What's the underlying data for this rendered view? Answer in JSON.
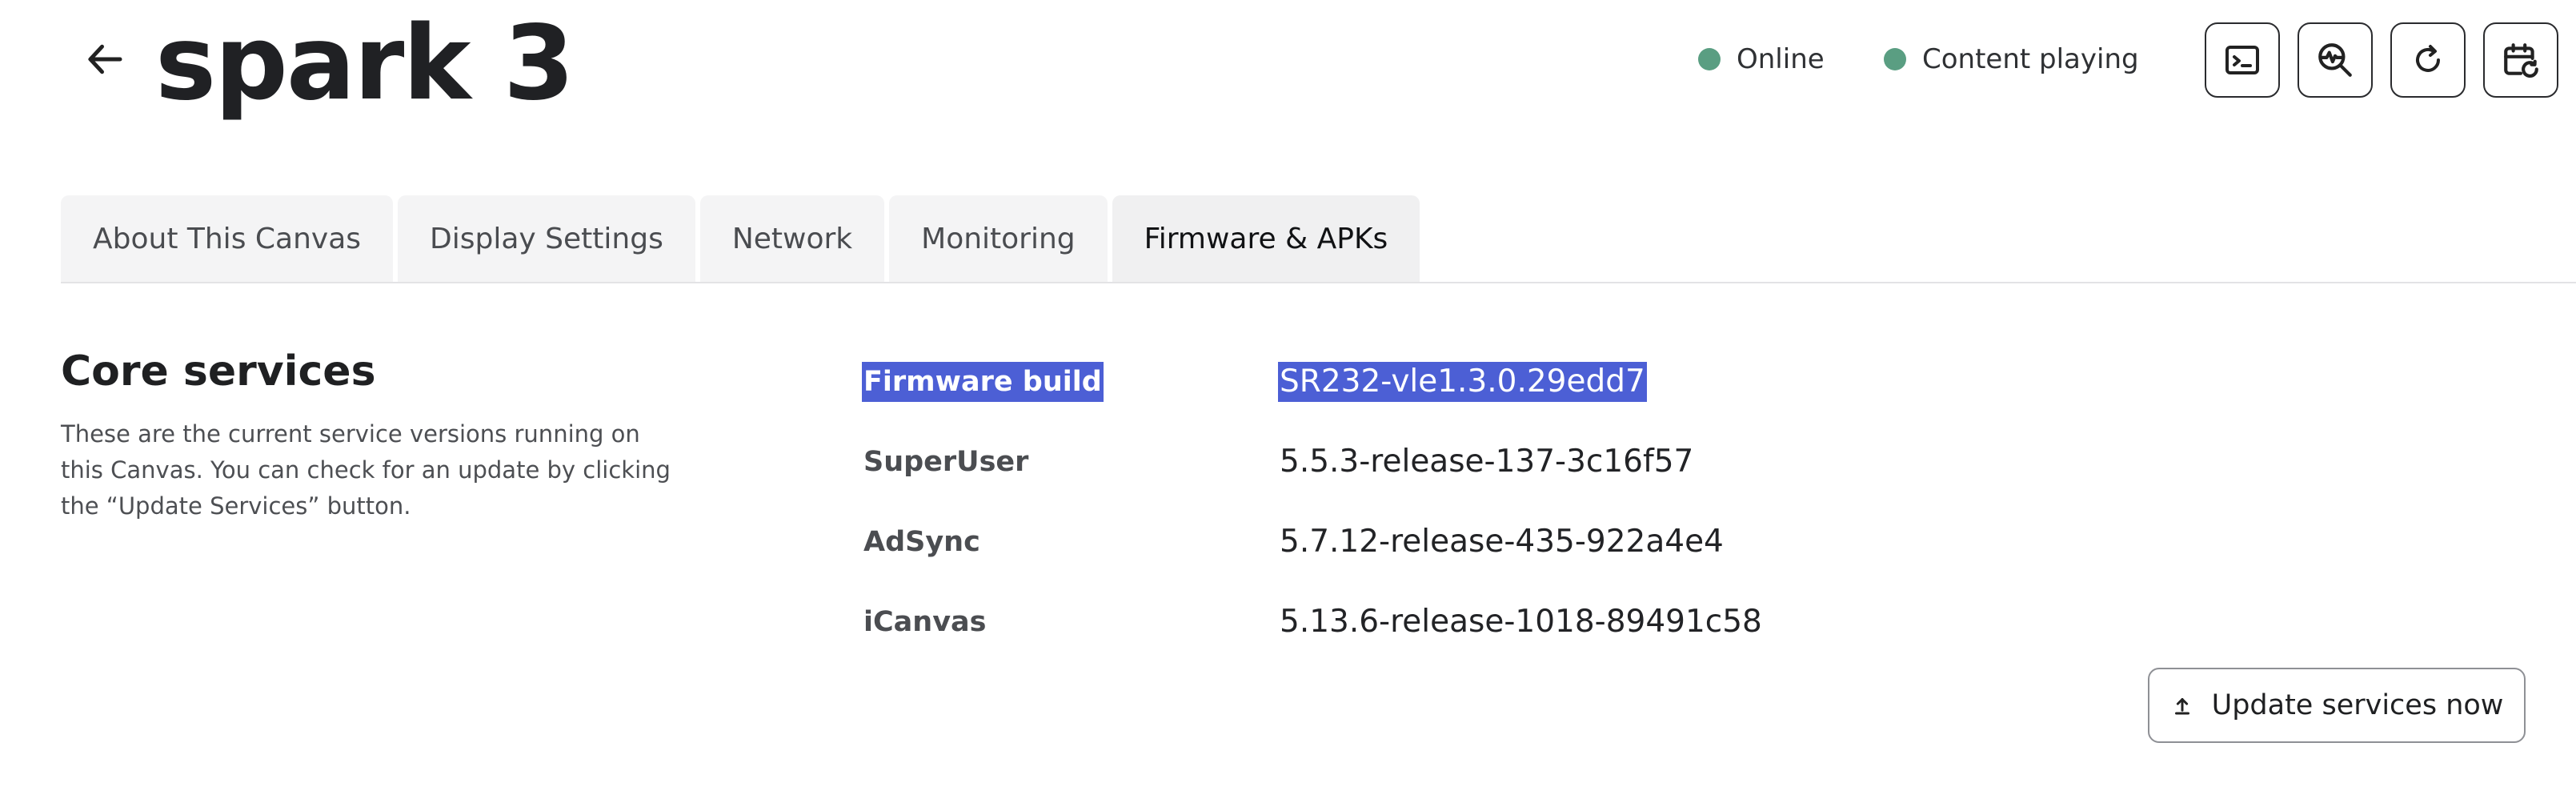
{
  "header": {
    "title": "spark 3",
    "status": [
      {
        "label": "Online",
        "color": "#5a9e82"
      },
      {
        "label": "Content playing",
        "color": "#5a9e82"
      }
    ],
    "actions": [
      "terminal-icon",
      "diagnostics-icon",
      "refresh-icon",
      "schedule-restart-icon"
    ]
  },
  "tabs": [
    {
      "label": "About This Canvas",
      "active": false
    },
    {
      "label": "Display Settings",
      "active": false
    },
    {
      "label": "Network",
      "active": false
    },
    {
      "label": "Monitoring",
      "active": false
    },
    {
      "label": "Firmware & APKs",
      "active": true
    }
  ],
  "core_services": {
    "title": "Core services",
    "description": "These are the current service versions running on this Canvas. You can check for an update by clicking the “Update Services” button.",
    "rows": [
      {
        "label": "Firmware build",
        "value": "SR232-vle1.3.0.29edd7",
        "selected": true
      },
      {
        "label": "SuperUser",
        "value": "5.5.3-release-137-3c16f57"
      },
      {
        "label": "AdSync",
        "value": "5.7.12-release-435-922a4e4"
      },
      {
        "label": "iCanvas",
        "value": "5.13.6-release-1018-89491c58"
      }
    ],
    "update_button": "Update services now"
  },
  "colors": {
    "accent_selection": "#4c5fd5",
    "status_green": "#5a9e82"
  }
}
